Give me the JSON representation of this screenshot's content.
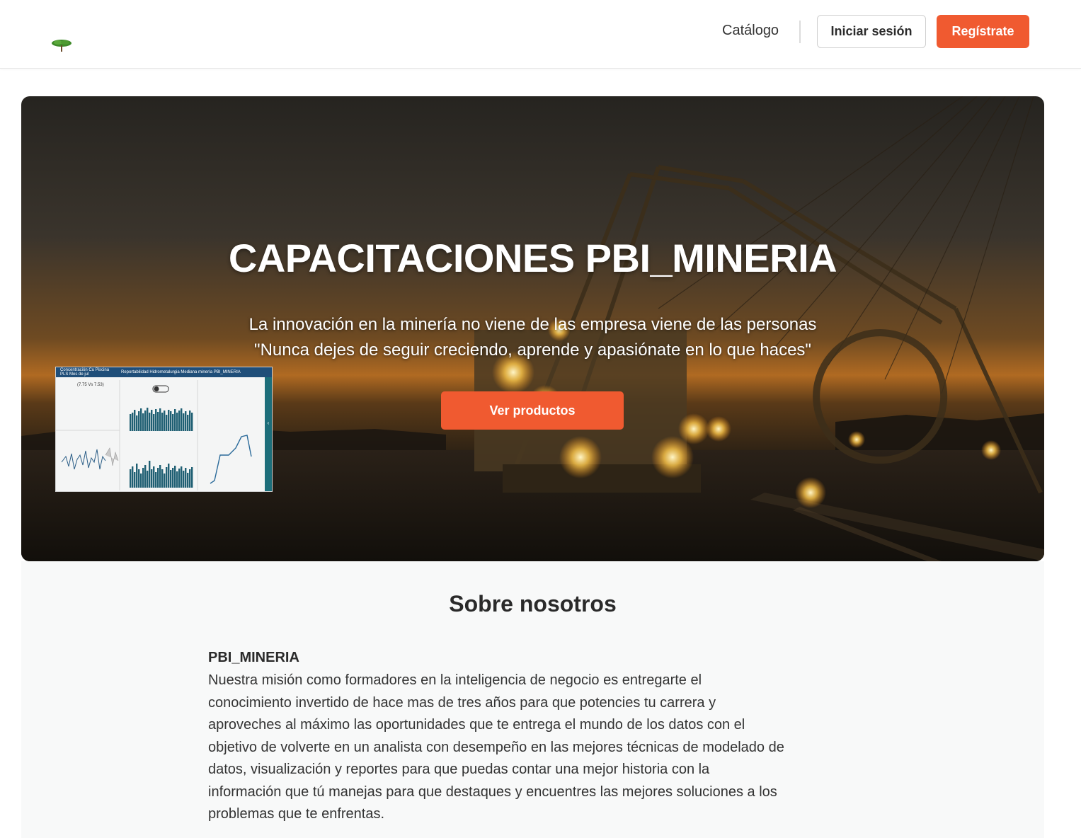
{
  "header": {
    "logo_icon": "tree-logo-icon",
    "nav_catalog": "Catálogo",
    "login_label": "Iniciar sesión",
    "register_label": "Regístrate",
    "accent_color": "#f05a30"
  },
  "hero": {
    "title": "CAPACITACIONES PBI_MINERIA",
    "subtitle_line1": "La innovación en la minería no viene de las empresa viene de las personas",
    "subtitle_line2": "\"Nunca dejes de seguir creciendo, aprende y apasiónate en lo que haces\"",
    "cta_label": "Ver productos",
    "dashboard_preview": {
      "header_left": "Concentración Cu Piscina PLS Mes de jul",
      "header_title": "Reportabilidad Hidrometalurgia Mediana minería PBI_MINERIA",
      "kpi": "(7.75 Vs 7.53)"
    }
  },
  "about": {
    "title": "Sobre nosotros",
    "org_name": "PBI_MINERIA",
    "description": "Nuestra misión como formadores en la inteligencia de negocio es entregarte el\nconocimiento invertido de hace mas de tres años para que potencies tu carrera y\naproveches al máximo las  oportunidades que te entrega el mundo de los datos con el\nobjetivo de volverte en un analista con desempeño en las mejores técnicas de modelado de\ndatos, visualización y reportes para que puedas contar una mejor historia con la\ninformación que tú manejas para que destaques y encuentres las mejores soluciones a los\nproblemas que te enfrentas."
  }
}
